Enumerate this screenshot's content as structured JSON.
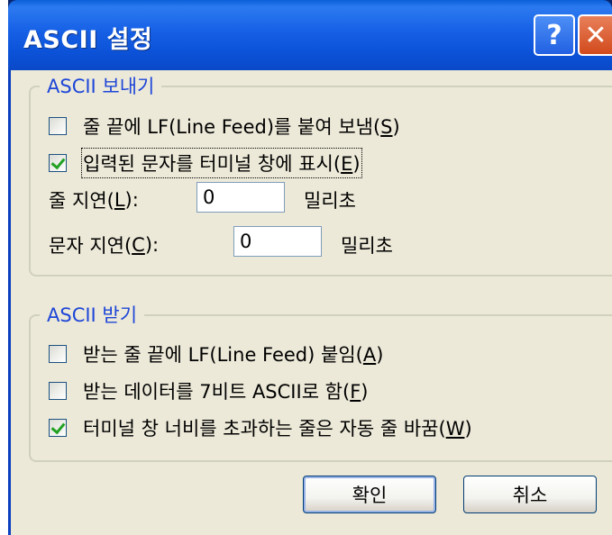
{
  "window": {
    "title": "ASCII 설정"
  },
  "send_group": {
    "legend": "ASCII 보내기",
    "append_lf": {
      "label": "줄 끝에 LF(Line Feed)를 붙여 보냄(",
      "key": "S",
      "suffix": ")",
      "checked": false
    },
    "echo_typed": {
      "label": "입력된 문자를 터미널 창에 표시(",
      "key": "E",
      "suffix": ")",
      "checked": true
    },
    "line_delay": {
      "label": "줄 지연(",
      "key": "L",
      "suffix": "):",
      "value": "0",
      "unit": "밀리초"
    },
    "char_delay": {
      "label": "문자 지연(",
      "key": "C",
      "suffix": "):",
      "value": "0",
      "unit": "밀리초"
    }
  },
  "receive_group": {
    "legend": "ASCII 받기",
    "append_lf": {
      "label": "받는 줄 끝에 LF(Line Feed) 붙임(",
      "key": "A",
      "suffix": ")",
      "checked": false
    },
    "force_7bit": {
      "label": "받는 데이터를 7비트 ASCII로 함(",
      "key": "F",
      "suffix": ")",
      "checked": false
    },
    "wrap_lines": {
      "label": "터미널 창 너비를 초과하는 줄은 자동 줄 바꿈(",
      "key": "W",
      "suffix": ")",
      "checked": true
    }
  },
  "buttons": {
    "ok": "확인",
    "cancel": "취소"
  },
  "icons": {
    "help": "help-icon",
    "close": "close-icon"
  },
  "colors": {
    "titlebar": "#0b52d8",
    "client": "#ece9d8",
    "legend": "#1e46d8",
    "checkmark": "#21a121"
  }
}
